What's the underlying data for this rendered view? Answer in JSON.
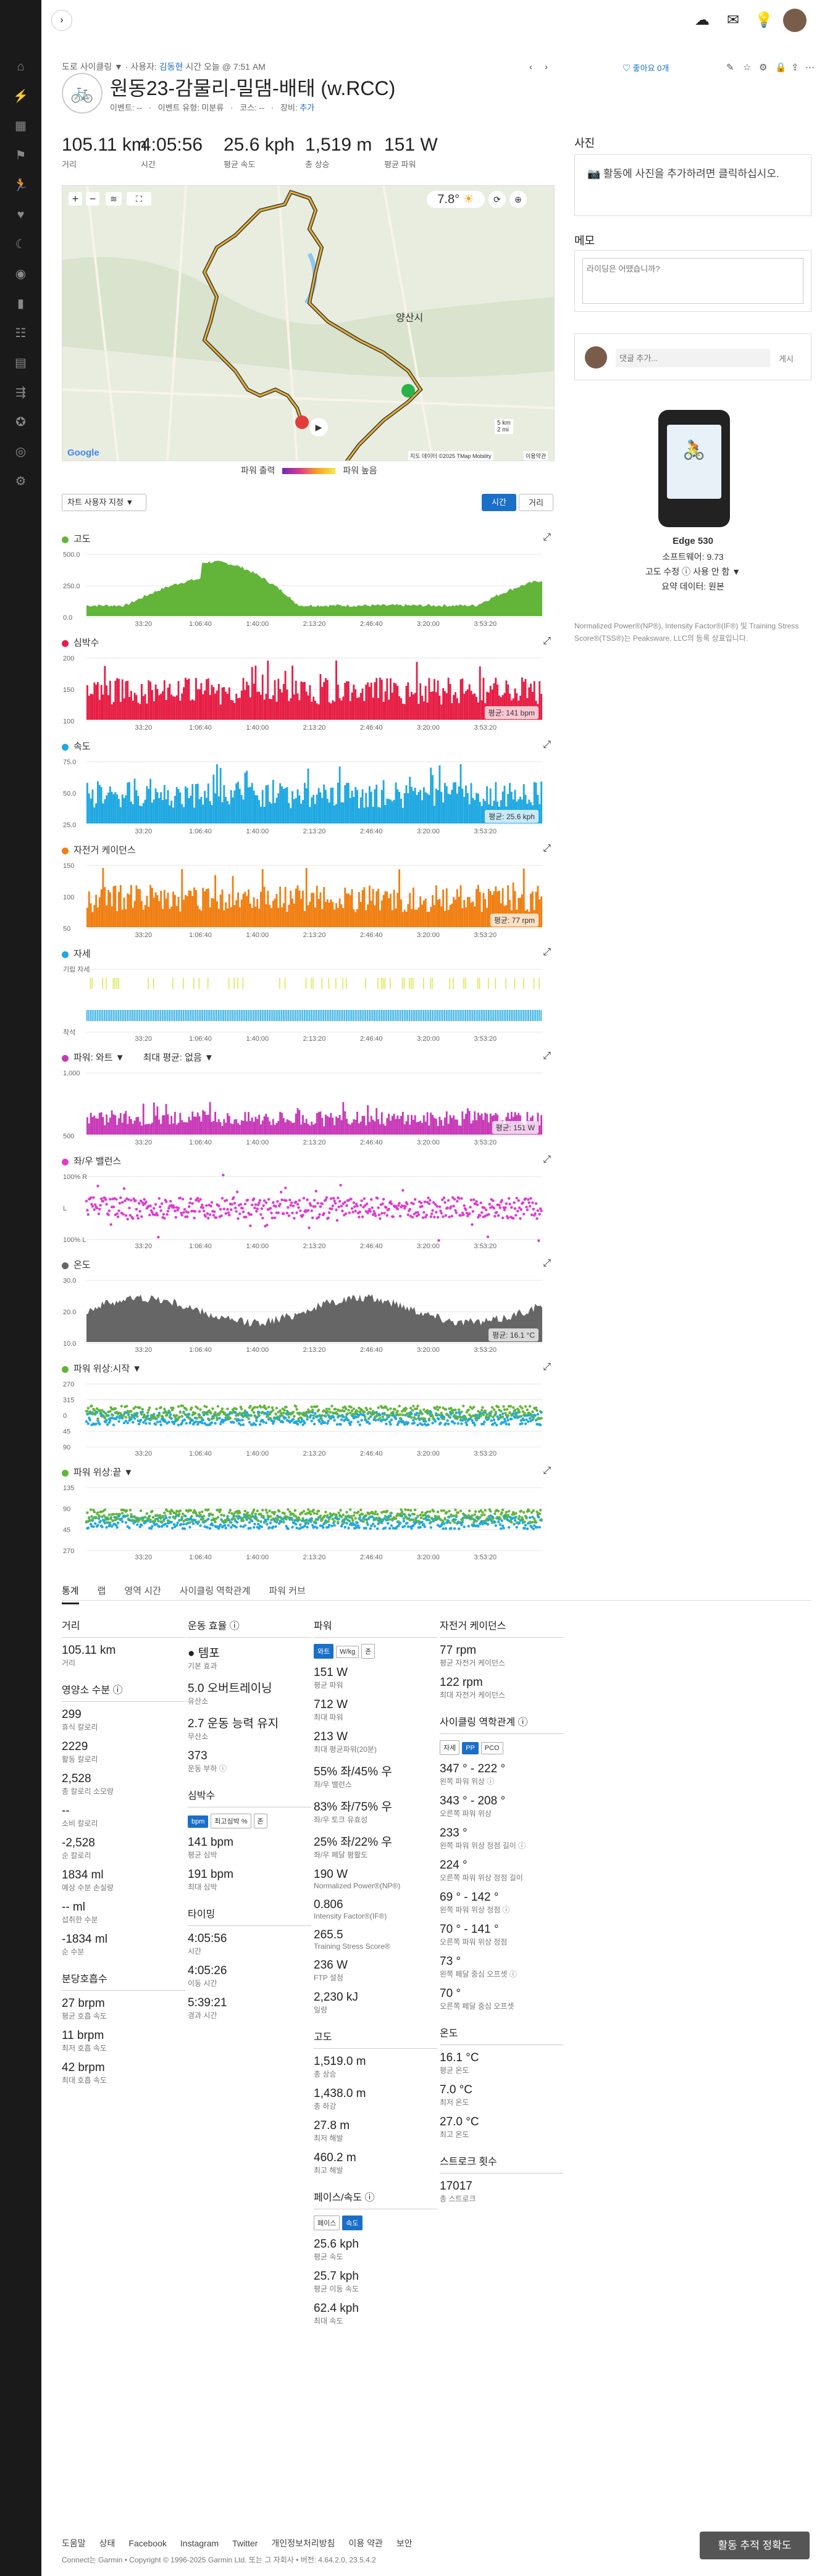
{
  "sidebar": {
    "icons": [
      "home-icon",
      "activity-icon",
      "calendar-icon",
      "courses-icon",
      "running-icon",
      "heart-icon",
      "sleep-icon",
      "workouts-icon",
      "reports-icon",
      "connections-icon",
      "stats-icon",
      "segments-icon",
      "badges-icon",
      "goals-icon",
      "settings-icon"
    ]
  },
  "topbar": {
    "icons": [
      "upload-icon",
      "inbox-icon",
      "tips-icon",
      "avatar"
    ]
  },
  "header": {
    "breadcrumb_prefix": "도로 사이클링 ▼ · 사용자:",
    "user": "김동현",
    "time_text": "시간 오늘 @ 7:51 AM",
    "title": "원동23-감물리-밀댐-배태 (w.RCC)",
    "meta_event": "이벤트: --",
    "meta_type": "이벤트 유형: 미분류",
    "meta_course": "코스: --",
    "meta_gear_label": "장비:",
    "meta_gear_link": "추가",
    "like_text": "좋아요 0개"
  },
  "summary": [
    {
      "value": "105.11 km",
      "label": "거리"
    },
    {
      "value": "4:05:56",
      "label": "시간"
    },
    {
      "value": "25.6 kph",
      "label": "평균 속도"
    },
    {
      "value": "1,519 m",
      "label": "총 상승"
    },
    {
      "value": "151 W",
      "label": "평균 파워"
    }
  ],
  "map": {
    "place_label": "양산시",
    "temp": "7.8°",
    "legend_low": "파워 출력",
    "legend_high": "파워 높음",
    "attribution": "지도 데이터 ©2025 TMap Mobility",
    "scale1": "5 km",
    "scale2": "2 mi",
    "terms": "이용약관",
    "google": "Google"
  },
  "controls": {
    "chart_options": "차트 사용자 지정 ▼",
    "toggle_time": "시간",
    "toggle_dist": "거리"
  },
  "charts": [
    {
      "name": "고도",
      "color": "#62b539",
      "y_ticks": [
        "500.0",
        "250.0",
        "0.0"
      ],
      "kind": "area",
      "avg": ""
    },
    {
      "name": "심박수",
      "color": "#e61e45",
      "y_ticks": [
        "200",
        "150",
        "100"
      ],
      "kind": "bar",
      "avg": "평균: 141 bpm"
    },
    {
      "name": "속도",
      "color": "#1fa8e1",
      "y_ticks": [
        "75.0",
        "50.0",
        "25.0"
      ],
      "kind": "bar",
      "avg": "평균: 25.6 kph"
    },
    {
      "name": "자전거 케이던스",
      "color": "#f07f12",
      "y_ticks": [
        "150",
        "100",
        "50"
      ],
      "kind": "bar",
      "avg": "평균: 77 rpm"
    },
    {
      "name": "자세",
      "color": "#1fa8e1",
      "y_ticks": [
        "기립 자세",
        "착석"
      ],
      "kind": "posture",
      "avg": ""
    },
    {
      "name": "파워: 와트 ▼",
      "color": "#c83ab8",
      "y_ticks": [
        "1,000",
        "500"
      ],
      "kind": "bar",
      "avg": "평균: 151 W",
      "extra": "최대 평균: 없음 ▼"
    },
    {
      "name": "좌/우 밸런스",
      "color": "#e03ad0",
      "y_ticks": [
        "100% R",
        "L",
        "100% L"
      ],
      "kind": "scatter",
      "avg": ""
    },
    {
      "name": "온도",
      "color": "#666666",
      "y_ticks": [
        "30.0",
        "20.0",
        "10.0"
      ],
      "kind": "area",
      "avg": "평균: 16.1 °C"
    },
    {
      "name": "파워 위상:시작 ▼",
      "color": "#62b539",
      "y_ticks": [
        "270",
        "315",
        "0",
        "45",
        "90"
      ],
      "kind": "phase",
      "avg": ""
    },
    {
      "name": "파워 위상:끝 ▼",
      "color": "#62b539",
      "y_ticks": [
        "135",
        "90",
        "45",
        "270"
      ],
      "kind": "phase",
      "avg": ""
    }
  ],
  "x_ticks": [
    "33:20",
    "1:06:40",
    "1:40:00",
    "2:13:20",
    "2:46:40",
    "3:20:00",
    "3:53:20"
  ],
  "side": {
    "photos_title": "사진",
    "photos_text": "활동에 사진을 추가하려면 클릭하십시오.",
    "notes_title": "메모",
    "notes_placeholder": "라이딩은 어땠습니까?",
    "comment_placeholder": "댓글 추가...",
    "comment_btn": "게시",
    "device_name": "Edge 530",
    "device_sw": "소프트웨어: 9.73",
    "device_elev": "고도 수정 ⓘ 사용 안 함 ▼",
    "device_summary": "요약 데이터: 원본",
    "trademark": "Normalized Power®(NP®), Intensity Factor®(IF®) 및 Training Stress Score®(TSS®)는 Peaksware, LLC의 등록 상표입니다.",
    "trademark_link": "Peaksware, LLC."
  },
  "tabs": [
    "통계",
    "랩",
    "영역 시간",
    "사이클링 역학관계",
    "파워 커브"
  ],
  "stats": {
    "col1": [
      {
        "sec": "거리",
        "items": [
          {
            "v": "105.11 km",
            "l": "거리"
          }
        ]
      },
      {
        "sec": "영양소 수분 ⓘ",
        "items": [
          {
            "v": "299",
            "l": "휴식 칼로리"
          },
          {
            "v": "2229",
            "l": "활동 칼로리"
          },
          {
            "v": "2,528",
            "l": "총 칼로리 소모량"
          },
          {
            "v": "--",
            "l": "소비 칼로리"
          },
          {
            "v": "-2,528",
            "l": "순 칼로리"
          },
          {
            "v": "1834 ml",
            "l": "예상 수분 손실량"
          },
          {
            "v": "-- ml",
            "l": "섭취한 수분"
          },
          {
            "v": "-1834 ml",
            "l": "순 수분"
          }
        ]
      },
      {
        "sec": "분당호흡수",
        "items": [
          {
            "v": "27 brpm",
            "l": "평균 호흡 속도"
          },
          {
            "v": "11 brpm",
            "l": "최저 호흡 속도"
          },
          {
            "v": "42 brpm",
            "l": "최대 호흡 속도"
          }
        ]
      }
    ],
    "col2": [
      {
        "sec": "운동 효율 ⓘ",
        "items": [
          {
            "v": "● 템포",
            "l": "기본 효과"
          },
          {
            "v": "5.0 오버트레이닝",
            "l": "유산소"
          },
          {
            "v": "2.7 운동 능력 유지",
            "l": "무산소"
          },
          {
            "v": "373",
            "l": "운동 부하 ⓘ"
          }
        ]
      },
      {
        "sec": "심박수",
        "items": [
          {
            "v": "141 bpm",
            "l": "평균 심박"
          },
          {
            "v": "191 bpm",
            "l": "최대 심박"
          }
        ]
      },
      {
        "sec": "타이밍",
        "items": [
          {
            "v": "4:05:56",
            "l": "시간"
          },
          {
            "v": "4:05:26",
            "l": "이동 시간"
          },
          {
            "v": "5:39:21",
            "l": "경과 시간"
          }
        ]
      }
    ],
    "col3": [
      {
        "sec": "파워",
        "items": [
          {
            "v": "151 W",
            "l": "평균 파워"
          },
          {
            "v": "712 W",
            "l": "최대 파워"
          },
          {
            "v": "213 W",
            "l": "최대 평균파워(20분)"
          },
          {
            "v": "55% 좌/45% 우",
            "l": "좌/우 밸런스"
          },
          {
            "v": "83% 좌/75% 우",
            "l": "좌/우 토크 유효성"
          },
          {
            "v": "25% 좌/22% 우",
            "l": "좌/우 페달 평활도"
          },
          {
            "v": "190 W",
            "l": "Normalized Power®(NP®)"
          },
          {
            "v": "0.806",
            "l": "Intensity Factor®(IF®)"
          },
          {
            "v": "265.5",
            "l": "Training Stress Score®"
          },
          {
            "v": "236 W",
            "l": "FTP 설정"
          },
          {
            "v": "2,230 kJ",
            "l": "일량"
          }
        ]
      },
      {
        "sec": "고도",
        "items": [
          {
            "v": "1,519.0 m",
            "l": "총 상승"
          },
          {
            "v": "1,438.0 m",
            "l": "총 하강"
          },
          {
            "v": "27.8 m",
            "l": "최저 해발"
          },
          {
            "v": "460.2 m",
            "l": "최고 해발"
          }
        ]
      },
      {
        "sec": "페이스/속도 ⓘ",
        "items": [
          {
            "v": "25.6 kph",
            "l": "평균 속도"
          },
          {
            "v": "25.7 kph",
            "l": "평균 이동 속도"
          },
          {
            "v": "62.4 kph",
            "l": "최대 속도"
          }
        ]
      }
    ],
    "col4": [
      {
        "sec": "자전거 케이던스",
        "items": [
          {
            "v": "77 rpm",
            "l": "평균 자전거 케이던스"
          },
          {
            "v": "122 rpm",
            "l": "최대 자전거 케이던스"
          }
        ]
      },
      {
        "sec": "사이클링 역학관계 ⓘ",
        "items": [
          {
            "v": "347 ° - 222 °",
            "l": "왼쪽 파워 위상 ⓘ"
          },
          {
            "v": "343 ° - 208 °",
            "l": "오른쪽 파워 위상"
          },
          {
            "v": "233 °",
            "l": "왼쪽 파워 위상 정점 길이 ⓘ"
          },
          {
            "v": "224 °",
            "l": "오른쪽 파워 위상 정점 길이"
          },
          {
            "v": "69 ° - 142 °",
            "l": "왼쪽 파워 위상 정점 ⓘ"
          },
          {
            "v": "70 ° - 141 °",
            "l": "오른쪽 파워 위상 정점"
          },
          {
            "v": "73 °",
            "l": "왼쪽 페달 중심 오프셋 ⓘ"
          },
          {
            "v": "70 °",
            "l": "오른쪽 페달 중심 오프셋"
          }
        ]
      },
      {
        "sec": "온도",
        "items": [
          {
            "v": "16.1 °C",
            "l": "평균 온도"
          },
          {
            "v": "7.0 °C",
            "l": "최저 온도"
          },
          {
            "v": "27.0 °C",
            "l": "최고 온도"
          }
        ]
      },
      {
        "sec": "스트로크 횟수",
        "items": [
          {
            "v": "17017",
            "l": "총 스트로크"
          }
        ]
      }
    ]
  },
  "footer": {
    "links": [
      "도움말",
      "상태",
      "Facebook",
      "Instagram",
      "Twitter",
      "개인정보처리방침",
      "이용 약관",
      "보안"
    ],
    "copyright": "Connect는 Garmin • Copyright © 1996-2025 Garmin Ltd. 또는 그 자회사 • 버전: 4.64.2.0, 23.5.4.2",
    "feedback": "활동 추적 정확도"
  }
}
